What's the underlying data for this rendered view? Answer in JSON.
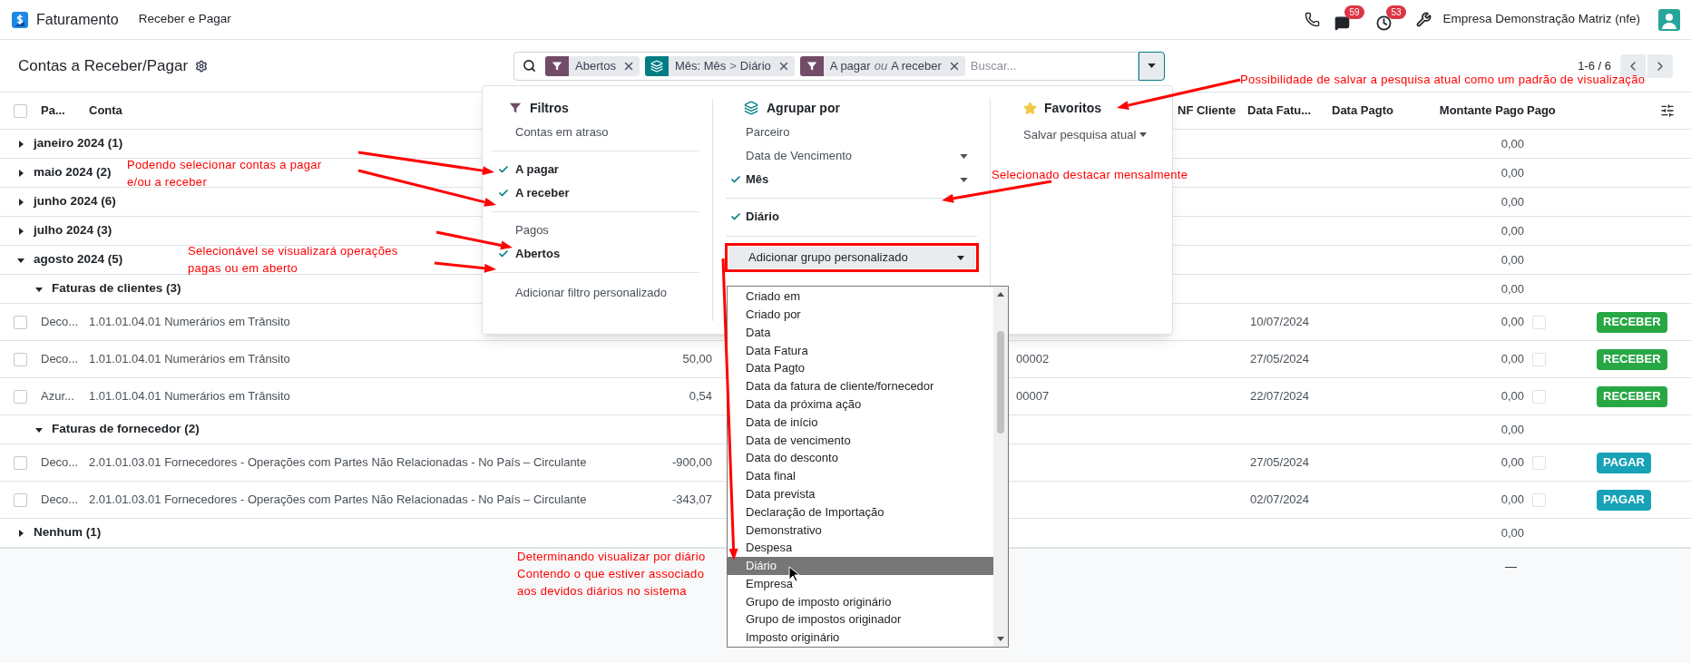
{
  "navbar": {
    "app": "Faturamento",
    "menu": [
      "Receber e Pagar"
    ],
    "messages_badge": "59",
    "activities_badge": "53",
    "company": "Empresa Demonstração Matriz (nfe)"
  },
  "control_panel": {
    "title": "Contas a Receber/Pagar",
    "facets": [
      {
        "kind": "filter",
        "values": [
          "Abertos"
        ]
      },
      {
        "kind": "groupby",
        "values": [
          "Mês: Mês",
          "Diário"
        ],
        "separator": ">"
      },
      {
        "kind": "filter",
        "values": [
          "A pagar",
          "A receber"
        ],
        "separator": "ou"
      }
    ],
    "search": {
      "placeholder": "Buscar..."
    },
    "pager": "1-6 / 6"
  },
  "popover": {
    "filters": {
      "title": "Filtros",
      "sections": [
        [
          {
            "label": "Contas em atraso",
            "checked": false
          }
        ],
        [
          {
            "label": "A pagar",
            "checked": true
          },
          {
            "label": "A receber",
            "checked": true
          }
        ],
        [
          {
            "label": "Pagos",
            "checked": false
          },
          {
            "label": "Abertos",
            "checked": true
          }
        ]
      ],
      "custom": "Adicionar filtro personalizado"
    },
    "groupby": {
      "title": "Agrupar por",
      "sections": [
        [
          {
            "label": "Parceiro",
            "checked": false,
            "has_options": false
          },
          {
            "label": "Data de Vencimento",
            "checked": false,
            "has_options": true
          },
          {
            "label": "Mês",
            "checked": true,
            "has_options": true
          }
        ],
        [
          {
            "label": "Diário",
            "checked": true,
            "has_options": false
          }
        ]
      ],
      "custom_group": {
        "label": "Adicionar grupo personalizado",
        "options": [
          {
            "label": "Criado em",
            "selected": false
          },
          {
            "label": "Criado por",
            "selected": false
          },
          {
            "label": "Data",
            "selected": false
          },
          {
            "label": "Data Fatura",
            "selected": false
          },
          {
            "label": "Data Pagto",
            "selected": false
          },
          {
            "label": "Data da fatura de cliente/fornecedor",
            "selected": false
          },
          {
            "label": "Data da próxima ação",
            "selected": false
          },
          {
            "label": "Data de início",
            "selected": false
          },
          {
            "label": "Data de vencimento",
            "selected": false
          },
          {
            "label": "Data do desconto",
            "selected": false
          },
          {
            "label": "Data final",
            "selected": false
          },
          {
            "label": "Data prevista",
            "selected": false
          },
          {
            "label": "Declaração de Importação",
            "selected": false
          },
          {
            "label": "Demonstrativo",
            "selected": false
          },
          {
            "label": "Despesa",
            "selected": false
          },
          {
            "label": "Diário",
            "selected": true
          },
          {
            "label": "Empresa",
            "selected": false
          },
          {
            "label": "Grupo de imposto originário",
            "selected": false
          },
          {
            "label": "Grupo de impostos originador",
            "selected": false
          },
          {
            "label": "Imposto originário",
            "selected": false
          }
        ]
      }
    },
    "favorites": {
      "title": "Favoritos",
      "save": "Salvar pesquisa atual"
    }
  },
  "table": {
    "all_selected": false,
    "columns": [
      "Pa...",
      "Conta",
      "NF Cliente",
      "Data Fatu...",
      "Data Pagto",
      "Montante Pago",
      "Pago"
    ],
    "rows": [
      {
        "kind": "group",
        "label": "janeiro 2024 (1)",
        "expanded": false,
        "amount_paid": "0,00"
      },
      {
        "kind": "group",
        "label": "maio 2024 (2)",
        "expanded": false,
        "amount_paid": "0,00"
      },
      {
        "kind": "group",
        "label": "junho 2024 (6)",
        "expanded": false,
        "amount_paid": "0,00"
      },
      {
        "kind": "group",
        "label": "julho 2024 (3)",
        "expanded": false,
        "amount_paid": "0,00"
      },
      {
        "kind": "group",
        "label": "agosto 2024 (5)",
        "expanded": true,
        "amount_paid": "0,00",
        "children": [
          {
            "kind": "group",
            "label": "Faturas de clientes (3)",
            "expanded": true,
            "amount_paid": "0,00",
            "children": [
              {
                "kind": "record",
                "selected": false,
                "partner": "Deco...",
                "account": "1.01.01.04.01 Numerários em Trânsito",
                "invoice_date": "10/07/2024",
                "amount_paid": "0,00",
                "paid": false,
                "action": {
                  "kind": "receive",
                  "label": "RECEBER"
                }
              },
              {
                "kind": "record",
                "selected": false,
                "partner": "Deco...",
                "account": "1.01.01.04.01 Numerários em Trânsito",
                "amount": "50,00",
                "number": "00002",
                "invoice_date": "27/05/2024",
                "amount_paid": "0,00",
                "paid": false,
                "action": {
                  "kind": "receive",
                  "label": "RECEBER"
                }
              },
              {
                "kind": "record",
                "selected": false,
                "partner": "Azur...",
                "account": "1.01.01.04.01 Numerários em Trânsito",
                "amount": "0,54",
                "number": "00007",
                "invoice_date": "22/07/2024",
                "amount_paid": "0,00",
                "paid": false,
                "action": {
                  "kind": "receive",
                  "label": "RECEBER"
                }
              }
            ]
          },
          {
            "kind": "group",
            "label": "Faturas de fornecedor (2)",
            "expanded": true,
            "amount_paid": "0,00",
            "children": [
              {
                "kind": "record",
                "selected": false,
                "partner": "Deco...",
                "account": "2.01.01.03.01 Fornecedores - Operações com Partes Não Relacionadas - No País – Circulante",
                "amount": "-900,00",
                "invoice_date": "27/05/2024",
                "amount_paid": "0,00",
                "paid": false,
                "action": {
                  "kind": "pay",
                  "label": "PAGAR"
                }
              },
              {
                "kind": "record",
                "selected": false,
                "partner": "Deco...",
                "account": "2.01.01.03.01 Fornecedores - Operações com Partes Não Relacionadas - No País – Circulante",
                "amount": "-343,07",
                "invoice_date": "02/07/2024",
                "amount_paid": "0,00",
                "paid": false,
                "action": {
                  "kind": "pay",
                  "label": "PAGAR"
                }
              }
            ]
          }
        ]
      },
      {
        "kind": "group",
        "label": "Nenhum (1)",
        "expanded": false,
        "amount_paid": "0,00"
      }
    ],
    "total": "—"
  },
  "annotations": [
    {
      "lines": [
        "Possibilidade de salvar a pesquisa atual como um padrão de visualização"
      ]
    },
    {
      "lines": [
        "Podendo selecionar contas a pagar",
        "e/ou a receber"
      ]
    },
    {
      "lines": [
        "Selecionado destacar mensalmente"
      ]
    },
    {
      "lines": [
        "Selecionável se visualizará operações",
        "pagas ou em aberto"
      ]
    },
    {
      "lines": [
        "Determinando visualizar por diário",
        "Contendo o que estiver associado",
        "aos devidos diários no sistema"
      ]
    }
  ]
}
